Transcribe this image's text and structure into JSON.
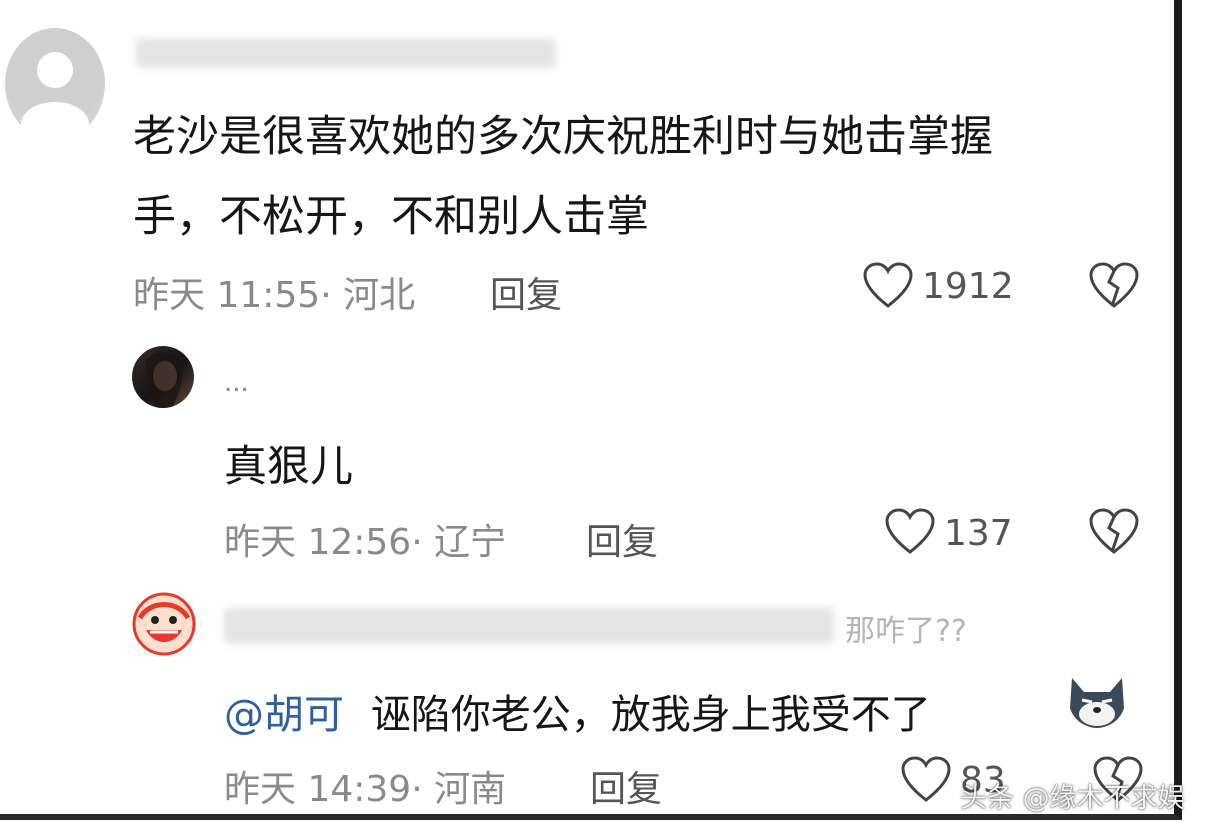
{
  "comments": [
    {
      "body": "老沙是很喜欢她的多次庆祝胜利时与她击掌握",
      "body_line2": "手，不松开，不和别人击掌",
      "meta": "昨天 11:55· 河北",
      "reply_label": "回复",
      "likes": "1912"
    },
    {
      "username": "...",
      "body": "真狠儿",
      "meta": "昨天 12:56· 辽宁",
      "reply_label": "回复",
      "likes": "137"
    },
    {
      "username_visible_tail": "那咋了??",
      "mention": "@胡可",
      "body": "诬陷你老公，放我身上我受不了",
      "meta": "昨天 14:39· 河南",
      "reply_label": "回复",
      "likes": "83"
    }
  ],
  "watermark": "头条 @缘木不求娱",
  "colors": {
    "mention": "#2f5fa0",
    "meta": "#8a8a8a",
    "text": "#161616"
  }
}
